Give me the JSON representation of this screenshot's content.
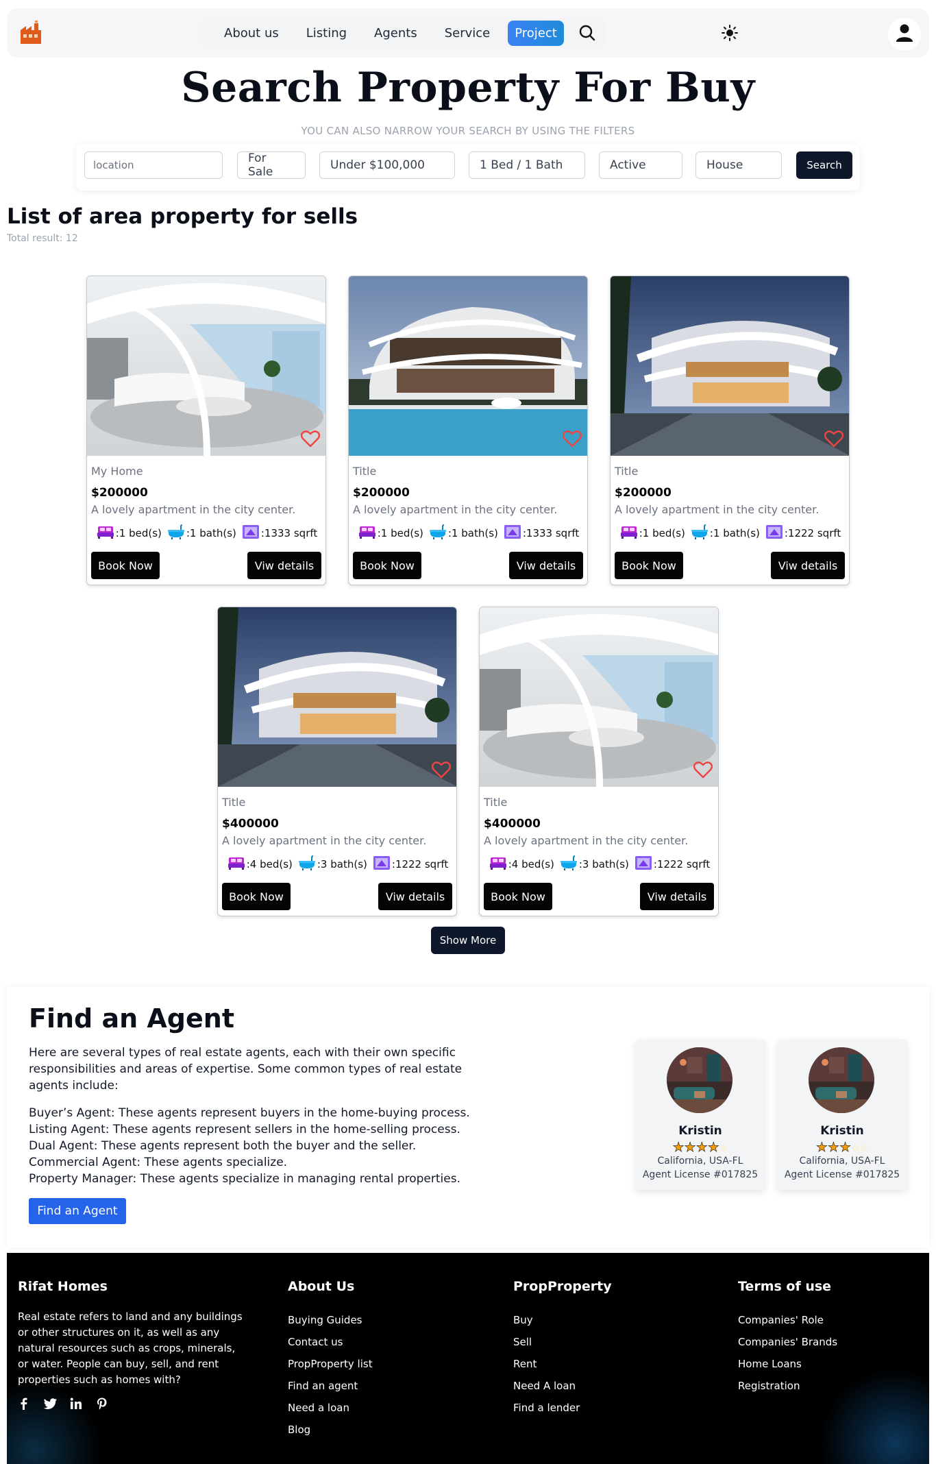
{
  "nav": {
    "links": [
      "About us",
      "Listing",
      "Agents",
      "Service"
    ],
    "active": "Project"
  },
  "hero": {
    "title": "Search Property For Buy",
    "subtitle": "YOU CAN ALSO NARROW YOUR SEARCH BY USING THE FILTERS"
  },
  "filters": {
    "location_placeholder": "location",
    "status": "For Sale",
    "price": "Under $100,000",
    "rooms": "1 Bed / 1 Bath",
    "state": "Active",
    "type": "House",
    "search_label": "Search"
  },
  "listing": {
    "title": "List of area property for sells",
    "total": "Total result: 12",
    "cards": [
      {
        "title": "My Home",
        "price": "$200000",
        "desc": "A lovely apartment in the city center.",
        "beds": ":1 bed(s)",
        "baths": ":1 bath(s)",
        "area": ":1333 sqrft",
        "image": "interior"
      },
      {
        "title": "Title",
        "price": "$200000",
        "desc": "A lovely apartment in the city center.",
        "beds": ":1 bed(s)",
        "baths": ":1 bath(s)",
        "area": ":1333 sqrft",
        "image": "villa-pool"
      },
      {
        "title": "Title",
        "price": "$200000",
        "desc": "A lovely apartment in the city center.",
        "beds": ":1 bed(s)",
        "baths": ":1 bath(s)",
        "area": ":1222 sqrft",
        "image": "villa-dusk"
      },
      {
        "title": "Title",
        "price": "$400000",
        "desc": "A lovely apartment in the city center.",
        "beds": ":4 bed(s)",
        "baths": ":3 bath(s)",
        "area": ":1222 sqrft",
        "image": "villa-dusk"
      },
      {
        "title": "Title",
        "price": "$400000",
        "desc": "A lovely apartment in the city center.",
        "beds": ":4 bed(s)",
        "baths": ":3 bath(s)",
        "area": ":1222 sqrft",
        "image": "interior"
      }
    ],
    "book_label": "Book Now",
    "view_label": "Viw details",
    "show_more": "Show More"
  },
  "agents": {
    "title": "Find an Agent",
    "intro": "Here are several types of real estate agents, each with their own specific responsibilities and areas of expertise. Some common types of real estate agents include:",
    "types": [
      "Buyer’s Agent: These agents represent buyers in the home-buying process.",
      "Listing Agent: These agents represent sellers in the home-selling process.",
      "Dual Agent: These agents represent both the buyer and the seller.",
      "Commercial Agent: These agents specialize.",
      "Property Manager: These agents specialize in managing rental properties."
    ],
    "button": "Find an Agent",
    "cards": [
      {
        "name": "Kristin",
        "rating": 4,
        "location": "California, USA-FL",
        "license": "Agent License #017825"
      },
      {
        "name": "Kristin",
        "rating": 3,
        "location": "California, USA-FL",
        "license": "Agent License #017825"
      }
    ]
  },
  "footer": {
    "brand": "Rifat Homes",
    "about": "Real estate refers to land and any buildings or other structures on it, as well as any natural resources such as crops, minerals, or water. People can buy, sell, and rent properties such as homes with?",
    "col2": {
      "title": "About Us",
      "links": [
        "Buying Guides",
        "Contact us",
        "PropProperty list",
        "Find an agent",
        "Need a loan",
        "Blog"
      ]
    },
    "col3": {
      "title": "PropProperty",
      "links": [
        "Buy",
        "Sell",
        "Rent",
        "Need A loan",
        "Find a lender"
      ]
    },
    "col4": {
      "title": "Terms of use",
      "links": [
        "Companies' Role",
        "Companies' Brands",
        "Home Loans",
        "Registration"
      ]
    },
    "socials": [
      "facebook-icon",
      "twitter-icon",
      "linkedin-icon",
      "pinterest-icon"
    ]
  },
  "colors": {
    "accent_blue": "#2563eb",
    "dark_button": "#0f172a",
    "heart": "#ef4444"
  }
}
